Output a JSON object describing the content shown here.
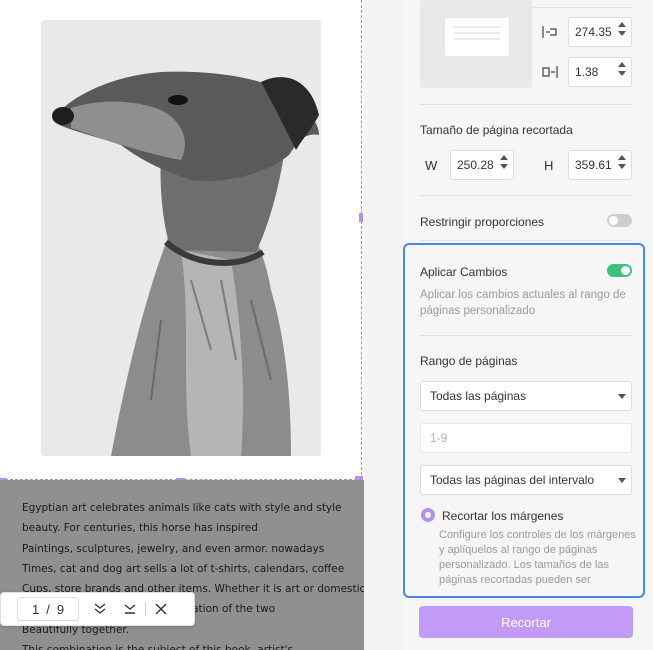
{
  "document": {
    "body_lines": [
      "Egyptian art celebrates animals like cats with style and style",
      "beauty. For centuries, this horse has inspired",
      "Paintings, sculptures, jewelry, and even armor. nowadays",
      "Times, cat and dog art sells a lot of t-shirts, calendars, coffee",
      "Cups, store brands and other items. Whether it is art or domestic",
      "animals, both shows the combination of the two",
      "Beautifully together.",
      "This combination is the subject of this book, artist's"
    ]
  },
  "pager": {
    "current_page": "1",
    "separator": "/",
    "total_pages": "9"
  },
  "panel": {
    "margin_right_value": "274.35",
    "margin_bottom_value": "1.38",
    "cropped_size": {
      "title": "Tamaño de página recortada",
      "width_label": "W",
      "width_value": "250.28",
      "height_label": "H",
      "height_value": "359.61"
    },
    "constrain_label": "Restringir proporciones",
    "constrain_on": false,
    "apply_changes": {
      "label": "Aplicar Cambios",
      "on": true,
      "description": "Aplicar los cambios actuales al rango de páginas personalizado"
    },
    "page_range": {
      "title": "Rango de páginas",
      "range_select": "Todas las páginas",
      "custom_placeholder": "1-9",
      "subset_select": "Todas las páginas del intervalo"
    },
    "trim_margins": {
      "label": "Recortar los márgenes",
      "description": "Configure los controles de los márgenes y aplíquelos al rango de páginas personalizado. Los tamaños de las páginas recortadas pueden ser"
    },
    "crop_button": "Recortar"
  },
  "colors": {
    "accent": "#b48ef0",
    "toggle_on": "#3ec27a",
    "toggle_off": "#cfcfcf",
    "highlight": "#4a86e8",
    "button": "#c29af8"
  }
}
